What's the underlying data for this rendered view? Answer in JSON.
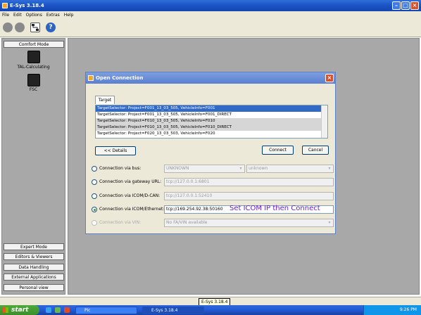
{
  "window": {
    "title": "E-Sys 3.18.4"
  },
  "menu": [
    "File",
    "Edit",
    "Options",
    "Extras",
    "Help"
  ],
  "sidebar": {
    "top_button": "Comfort Mode",
    "items": [
      {
        "label": "TAL-Calculating",
        "icon": "tal-calculating-icon"
      },
      {
        "label": "FSC",
        "icon": "fsc-icon"
      }
    ],
    "bottom_buttons": [
      "Expert Mode",
      "Editors & Viewers",
      "Data Handling",
      "External Applications",
      "Personal view"
    ]
  },
  "dialog": {
    "title": "Open Connection",
    "tab": "Target",
    "targets": [
      "TargetSelector: Project=F001_13_03_505, VehicleInfo=F001",
      "TargetSelector: Project=F001_13_03_505, VehicleInfo=F001_DIRECT",
      "TargetSelector: Project=F010_13_03_505, VehicleInfo=F010",
      "TargetSelector: Project=F010_13_03_505, VehicleInfo=F010_DIRECT",
      "TargetSelector: Project=F020_13_03_503, VehicleInfo=F020"
    ],
    "selected_index": 0,
    "details_button": "<< Details",
    "connect_button": "Connect",
    "cancel_button": "Cancel",
    "connections": [
      {
        "label": "Connection via bus:",
        "value": "UNKNOWN",
        "value2": "unknown",
        "selected": false,
        "enabled": true
      },
      {
        "label": "Connection via gateway URL:",
        "value": "tcp://127.0.0.1:6801",
        "selected": false,
        "enabled": true
      },
      {
        "label": "Connection via ICOM/D-CAN:",
        "value": "tcp://127.0.0.1:52410",
        "selected": false,
        "enabled": true
      },
      {
        "label": "Connection via ICOM/Ethernet:",
        "value": "tcp://169.254.92.38:50160",
        "selected": true,
        "enabled": true
      },
      {
        "label": "Connection via VIN:",
        "value": "No FA/VIN available",
        "selected": false,
        "enabled": false
      }
    ],
    "annotation": "Set ICOM IP then Connect"
  },
  "tooltip": "E-Sys 3.18.4",
  "taskbar": {
    "start": "start",
    "tasks": [
      "Pic",
      "E-Sys 3.18.4"
    ],
    "clock": "9:26 PM"
  }
}
